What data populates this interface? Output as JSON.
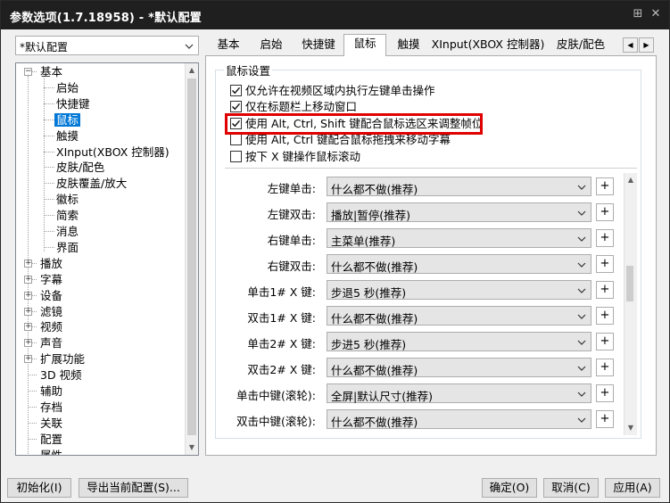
{
  "window": {
    "title": "参数选项(1.7.18958) - *默认配置"
  },
  "titlebar_icons": [
    "pin-icon",
    "close-icon"
  ],
  "profile": {
    "selected": "*默认配置"
  },
  "tree": {
    "items": [
      {
        "label": "基本",
        "level": 0,
        "expander": "−"
      },
      {
        "label": "启始",
        "level": 1
      },
      {
        "label": "快捷键",
        "level": 1
      },
      {
        "label": "鼠标",
        "level": 1,
        "selected": true
      },
      {
        "label": "触摸",
        "level": 1
      },
      {
        "label": "XInput(XBOX 控制器)",
        "level": 1
      },
      {
        "label": "皮肤/配色",
        "level": 1
      },
      {
        "label": "皮肤覆盖/放大",
        "level": 1
      },
      {
        "label": "徽标",
        "level": 1
      },
      {
        "label": "简索",
        "level": 1
      },
      {
        "label": "消息",
        "level": 1
      },
      {
        "label": "界面",
        "level": 1
      },
      {
        "label": "播放",
        "level": 0,
        "expander": "+"
      },
      {
        "label": "字幕",
        "level": 0,
        "expander": "+"
      },
      {
        "label": "设备",
        "level": 0,
        "expander": "+"
      },
      {
        "label": "滤镜",
        "level": 0,
        "expander": "+"
      },
      {
        "label": "视频",
        "level": 0,
        "expander": "+"
      },
      {
        "label": "声音",
        "level": 0,
        "expander": "+"
      },
      {
        "label": "扩展功能",
        "level": 0,
        "expander": "+"
      },
      {
        "label": "3D 视频",
        "level": 0
      },
      {
        "label": "辅助",
        "level": 0
      },
      {
        "label": "存档",
        "level": 0
      },
      {
        "label": "关联",
        "level": 0
      },
      {
        "label": "配置",
        "level": 0
      },
      {
        "label": "属性",
        "level": 0
      }
    ]
  },
  "tabs": [
    {
      "label": "基本"
    },
    {
      "label": "启始"
    },
    {
      "label": "快捷键"
    },
    {
      "label": "鼠标",
      "active": true
    },
    {
      "label": "触摸"
    },
    {
      "label": "XInput(XBOX 控制器)"
    },
    {
      "label": "皮肤/配色"
    }
  ],
  "group": {
    "title": "鼠标设置"
  },
  "checkboxes": [
    {
      "label": "仅允许在视频区域内执行左键单击操作",
      "checked": true
    },
    {
      "label": "仅在标题栏上移动窗口",
      "checked": true
    },
    {
      "label": "使用 Alt, Ctrl, Shift 键配合鼠标选区来调整帧位",
      "checked": true,
      "highlighted": true
    },
    {
      "label": "使用 Alt, Ctrl 键配合鼠标拖拽来移动字幕",
      "checked": false
    },
    {
      "label": "按下 X 键操作鼠标滚动",
      "checked": false
    }
  ],
  "actions": [
    {
      "label": "左键单击:",
      "value": "什么都不做(推荐)"
    },
    {
      "label": "左键双击:",
      "value": "播放|暂停(推荐)"
    },
    {
      "label": "右键单击:",
      "value": "主菜单(推荐)"
    },
    {
      "label": "右键双击:",
      "value": "什么都不做(推荐)"
    },
    {
      "label": "单击1# X 键:",
      "value": "步退5 秒(推荐)"
    },
    {
      "label": "双击1# X 键:",
      "value": "什么都不做(推荐)"
    },
    {
      "label": "单击2# X 键:",
      "value": "步进5 秒(推荐)"
    },
    {
      "label": "双击2# X 键:",
      "value": "什么都不做(推荐)"
    },
    {
      "label": "单击中键(滚轮):",
      "value": "全屏|默认尺寸(推荐)"
    },
    {
      "label": "双击中键(滚轮):",
      "value": "什么都不做(推荐)"
    },
    {
      "label": "",
      "value": ""
    }
  ],
  "plus_label": "+",
  "buttons": {
    "init": "初始化(I)",
    "export": "导出当前配置(S)...",
    "ok": "确定(O)",
    "cancel": "取消(C)",
    "apply": "应用(A)"
  }
}
